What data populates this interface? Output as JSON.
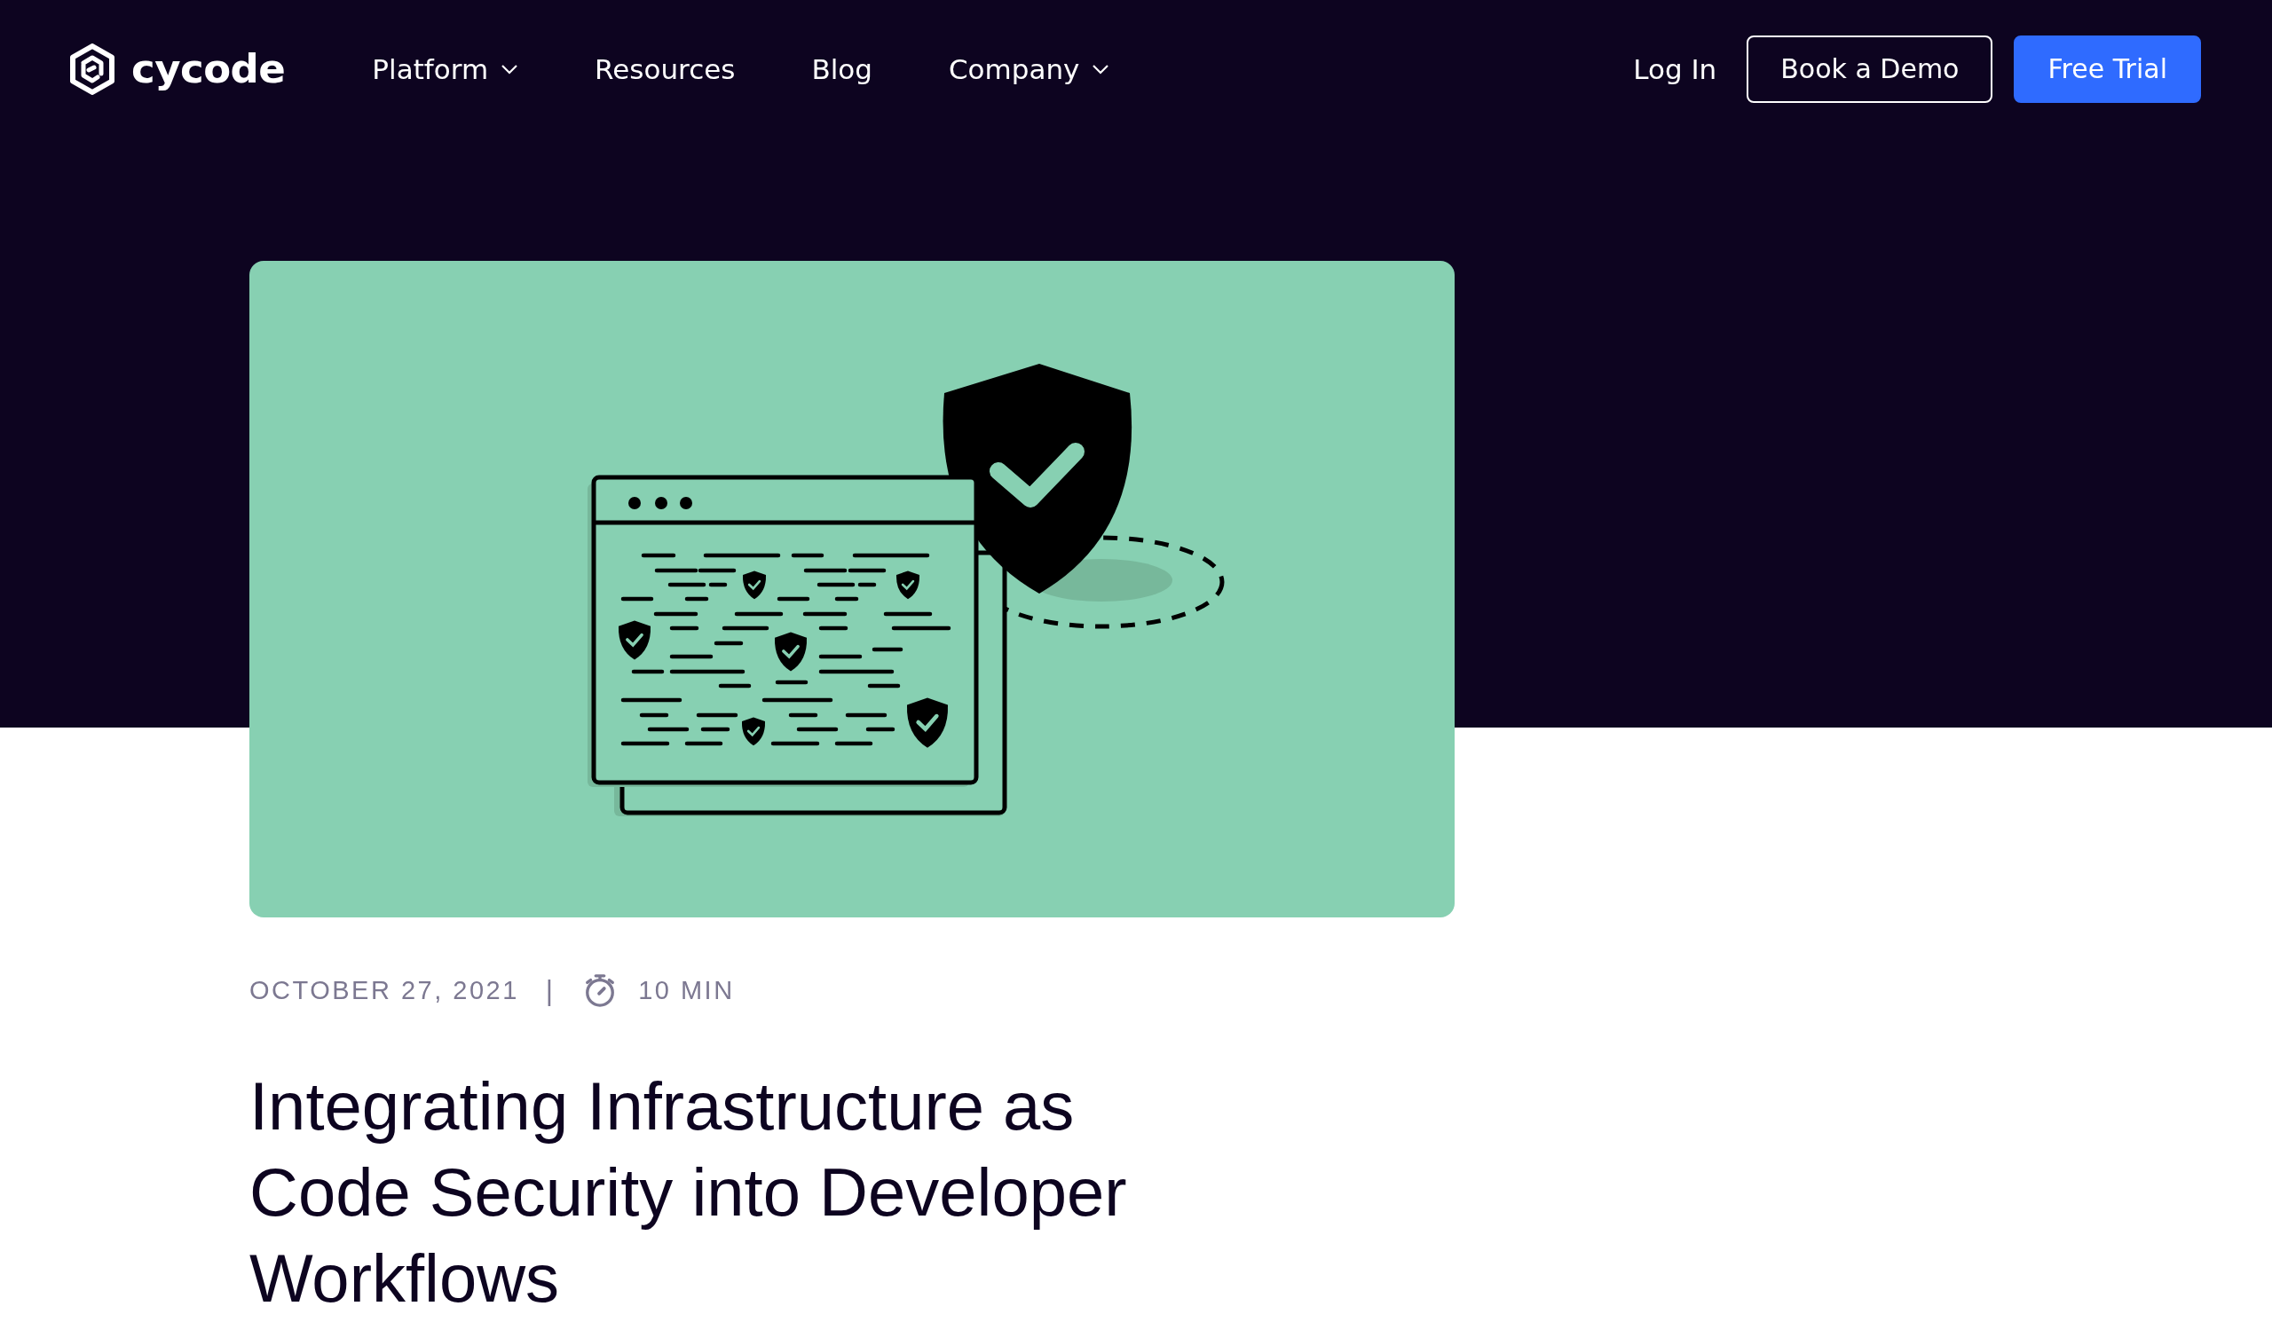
{
  "header": {
    "logo": "cycode",
    "nav": [
      {
        "label": "Platform",
        "has_menu": true
      },
      {
        "label": "Resources",
        "has_menu": false
      },
      {
        "label": "Blog",
        "has_menu": false
      },
      {
        "label": "Company",
        "has_menu": true
      }
    ],
    "login": "Log In",
    "buttons": [
      {
        "label": "Book a Demo",
        "kind": "outline"
      },
      {
        "label": "Free Trial",
        "kind": "primary"
      }
    ]
  },
  "article": {
    "date": "OCTOBER 27, 2021",
    "separator": "|",
    "read_time": "10 MIN",
    "title": "Integrating Infrastructure as Code Security into Developer Workflows"
  }
}
